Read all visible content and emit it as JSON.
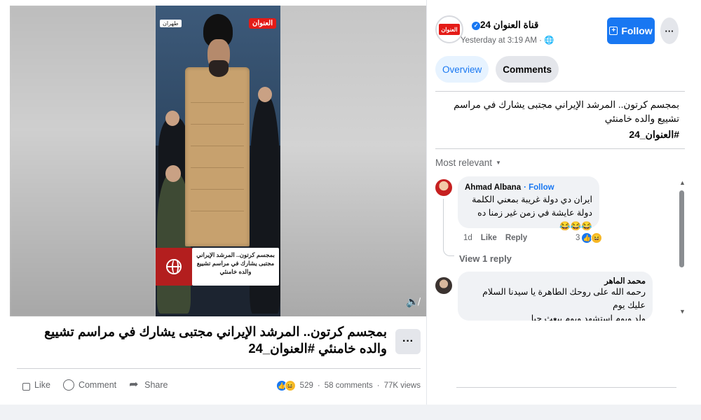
{
  "video": {
    "channel_logo_text": "العنوان",
    "location_tag": "طهران",
    "caption_lines": [
      "بمجسم كرتون.. المرشد الإيراني",
      "مجتبى يشارك في مراسم تشييع",
      "والده خامنئي"
    ],
    "mute_icon": "speaker-muted-icon"
  },
  "post": {
    "title": "بمجسم كرتون.. المرشد الإيراني مجتبى يشارك في مراسم تشييع والده خامنئي #العنوان_24",
    "more_label": "···",
    "actions": {
      "like": "Like",
      "comment": "Comment",
      "share": "Share"
    },
    "stats": {
      "reactions": "529",
      "comments": "58 comments",
      "views": "77K views"
    }
  },
  "sidebar": {
    "page_name": "قناة العنوان 24",
    "avatar_text": "العنوان",
    "time": "Yesterday at 3:19 AM · ",
    "follow_label": "Follow",
    "more_label": "···",
    "tabs": [
      "Overview",
      "Comments"
    ],
    "post_text": "بمجسم كرتون.. المرشد الإيراني مجتبى يشارك في مراسم تشييع والده خامنئي",
    "post_hashtag": "#العنوان_24",
    "sort_label": "Most relevant"
  },
  "comments": [
    {
      "author": "Ahmad Albana",
      "follow": "Follow",
      "lines": [
        "ايران دي دولة غريبة بمعني الكلمة",
        "دولة عايشة في زمن غير زمنا ده 😂😂😂"
      ],
      "age": "1d",
      "like": "Like",
      "reply": "Reply",
      "reactions": "3"
    },
    {
      "author": "محمد الماهر",
      "lines": [
        "رحمه الله على روحك الطاهرة يا سيدنا السلام عليك يوم",
        "ولد ويوم استشهد ويوم يبعث حيا"
      ]
    }
  ],
  "view_replies": "View 1 reply"
}
